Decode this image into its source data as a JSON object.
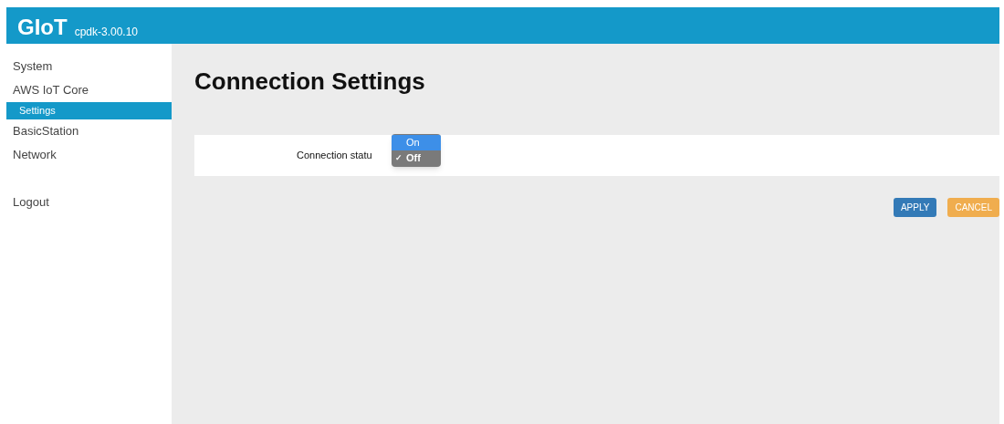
{
  "header": {
    "logo": "GIoT",
    "version": "cpdk-3.00.10"
  },
  "sidebar": {
    "items": [
      {
        "label": "System",
        "selected": false
      },
      {
        "label": "AWS IoT Core",
        "selected": false,
        "children": [
          {
            "label": "Settings",
            "selected": true
          }
        ]
      },
      {
        "label": "BasicStation",
        "selected": false
      },
      {
        "label": "Network",
        "selected": false
      }
    ],
    "logout": "Logout"
  },
  "page": {
    "title": "Connection Settings",
    "field": {
      "label": "Connection statu",
      "options": [
        {
          "label": "On",
          "selected": false,
          "highlighted": true
        },
        {
          "label": "Off",
          "selected": true,
          "highlighted": false,
          "check": "✓"
        }
      ]
    }
  },
  "buttons": [
    {
      "label": "APPLY",
      "kind": "primary"
    },
    {
      "label": "CANCEL",
      "kind": "warning"
    }
  ]
}
